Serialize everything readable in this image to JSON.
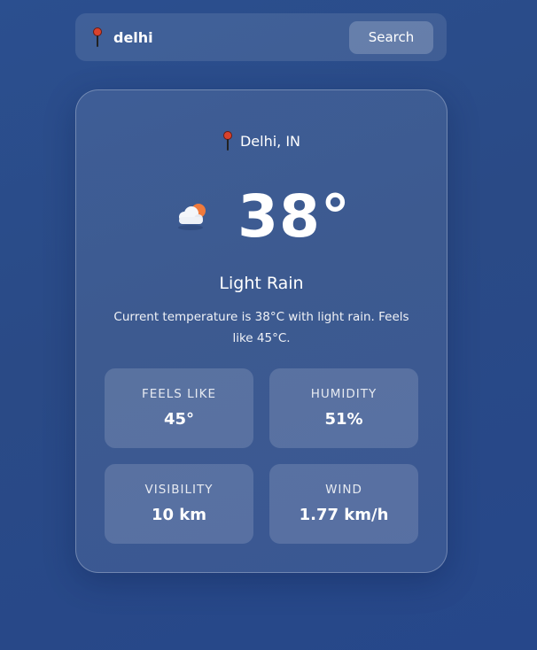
{
  "search": {
    "value": "delhi",
    "placeholder": "",
    "button_label": "Search",
    "icon": "location-pin-icon"
  },
  "weather": {
    "location": "Delhi, IN",
    "location_icon": "location-pin-icon",
    "condition_icon": "cloud-sun-icon",
    "temperature": "38°",
    "condition": "Light Rain",
    "description": "Current temperature is 38°C with light rain. Feels like 45°C."
  },
  "stats": {
    "feels_like": {
      "label": "FEELS LIKE",
      "value": "45°"
    },
    "humidity": {
      "label": "HUMIDITY",
      "value": "51%"
    },
    "visibility": {
      "label": "VISIBILITY",
      "value": "10 km"
    },
    "wind": {
      "label": "WIND",
      "value": "1.77 km/h"
    }
  },
  "colors": {
    "background": "#2a4a86",
    "pin_head": "#d9422c",
    "sun": "#f07a3c"
  }
}
